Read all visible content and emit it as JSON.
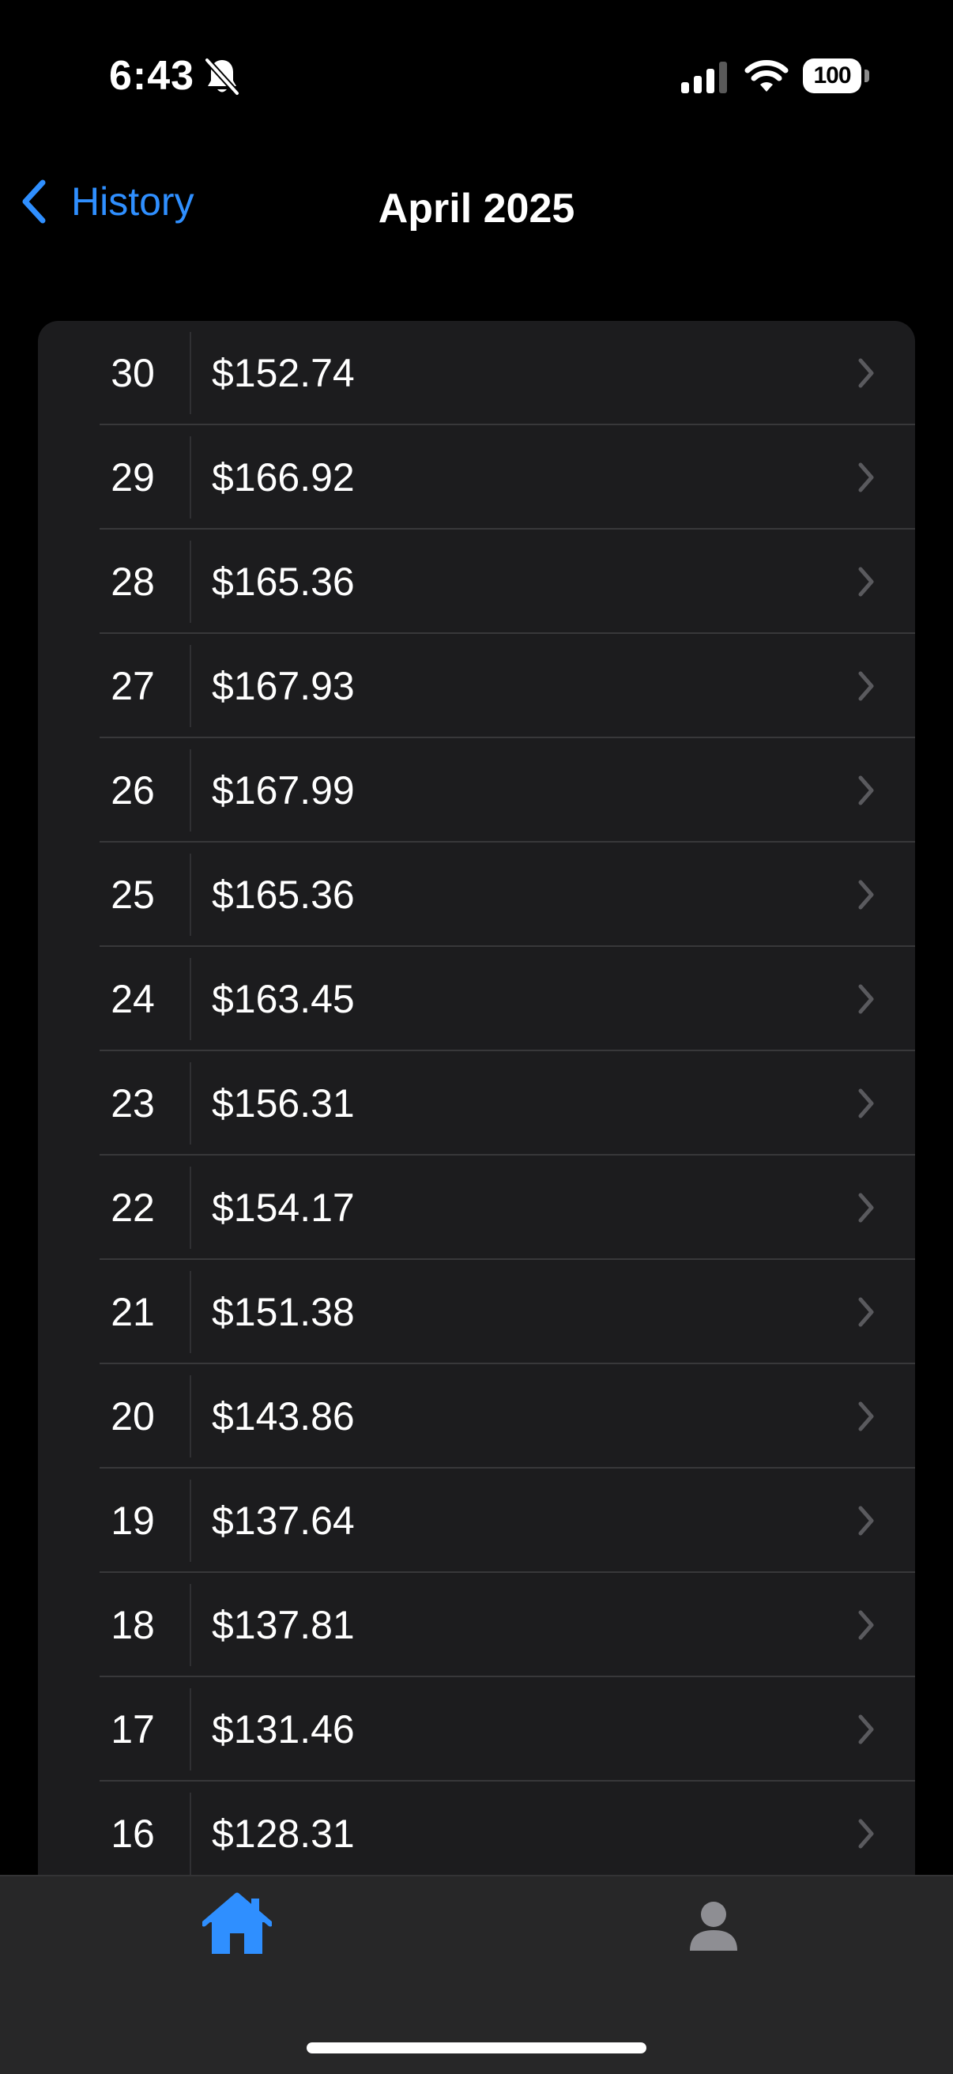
{
  "status_bar": {
    "time": "6:43",
    "battery": "100",
    "icons": [
      "bell-slash-icon",
      "cellular-signal-icon",
      "wifi-icon",
      "battery-icon"
    ]
  },
  "nav": {
    "back_label": "History",
    "title": "April 2025"
  },
  "history": {
    "rows": [
      {
        "day": "30",
        "amount": "$152.74"
      },
      {
        "day": "29",
        "amount": "$166.92"
      },
      {
        "day": "28",
        "amount": "$165.36"
      },
      {
        "day": "27",
        "amount": "$167.93"
      },
      {
        "day": "26",
        "amount": "$167.99"
      },
      {
        "day": "25",
        "amount": "$165.36"
      },
      {
        "day": "24",
        "amount": "$163.45"
      },
      {
        "day": "23",
        "amount": "$156.31"
      },
      {
        "day": "22",
        "amount": "$154.17"
      },
      {
        "day": "21",
        "amount": "$151.38"
      },
      {
        "day": "20",
        "amount": "$143.86"
      },
      {
        "day": "19",
        "amount": "$137.64"
      },
      {
        "day": "18",
        "amount": "$137.81"
      },
      {
        "day": "17",
        "amount": "$131.46"
      },
      {
        "day": "16",
        "amount": "$128.31"
      }
    ]
  },
  "tab_bar": {
    "tabs": [
      {
        "icon": "home-icon",
        "selected": true
      },
      {
        "icon": "person-icon",
        "selected": false
      }
    ]
  },
  "colors": {
    "accent": "#2f8fff",
    "background": "#000000",
    "card": "#1c1c1e",
    "tab_bar": "#272728",
    "chevron": "#5a5a5e",
    "inactive_icon": "#8e8e93"
  }
}
